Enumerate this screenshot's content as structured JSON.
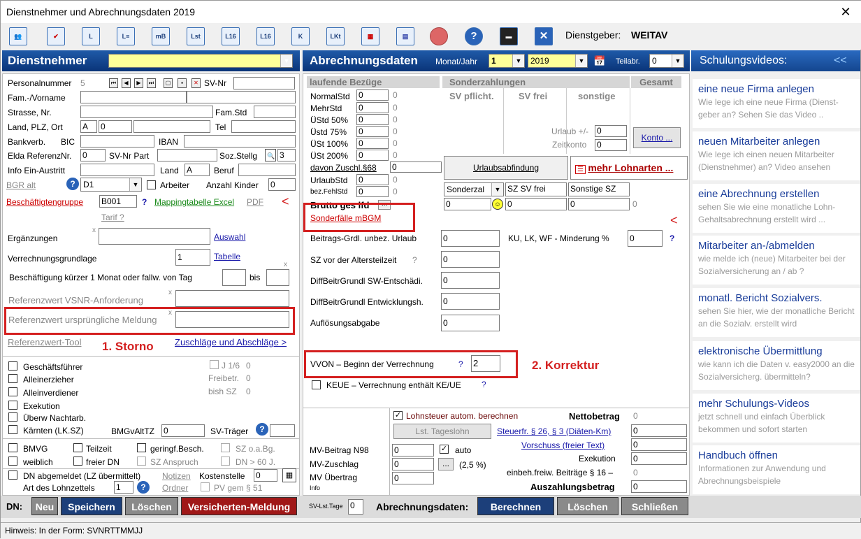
{
  "window": {
    "title": "Dienstnehmer und Abrechnungsdaten 2019",
    "close": "✕"
  },
  "toolbar": {
    "icons": [
      "users-icon",
      "checklist-icon",
      "L",
      "L≡",
      "mB",
      "Lst",
      "L16",
      "L16",
      "K",
      "LKt",
      "calendar-icon",
      "calculator-icon",
      "ball-icon",
      "help-icon",
      "clapper-icon",
      "close-icon"
    ],
    "employer_label": "Dienstgeber:",
    "employer_name": "WEITAV"
  },
  "dn_header": {
    "title": "Dienstnehmer"
  },
  "abr_header": {
    "title": "Abrechnungsdaten",
    "monat_jahr_label": "Monat/Jahr",
    "monat": "1",
    "jahr": "2019",
    "teilabr_label": "Teilabr.",
    "teilabr": "0"
  },
  "videos_header": {
    "title": "Schulungsvideos:",
    "collapse": "<<"
  },
  "dn": {
    "personalnummer_label": "Personalnummer",
    "personalnummer": "5",
    "svnr_label": "SV-Nr",
    "fam_vorname_label": "Fam.-/Vorname",
    "strasse_label": "Strasse, Nr.",
    "famstd_label": "Fam.Std",
    "land_plz_ort_label": "Land, PLZ, Ort",
    "land": "A",
    "plz": "0",
    "tel_label": "Tel",
    "bankverb_label": "Bankverb.",
    "bic_label": "BIC",
    "iban_label": "IBAN",
    "elda_label": "Elda ReferenzNr.",
    "elda": "0",
    "svnr_part_label": "SV-Nr Part",
    "soz_stellg_label": "Soz.Stellg",
    "soz_stellg": "3",
    "info_label": "Info Ein-Austritt",
    "land2_label": "Land",
    "land2": "A",
    "beruf_label": "Beruf",
    "bgr_alt": "BGR alt",
    "bgr_value": "D1",
    "arbeiter_label": "Arbeiter",
    "kinder_label": "Anzahl Kinder",
    "kinder": "0",
    "beschgrp_label": "Beschäftigtengruppe",
    "beschgrp": "B001",
    "q": "?",
    "mapping_label": "Mappingtabelle Excel",
    "pdf_label": "PDF",
    "arrow": "<",
    "tarif": "Tarif ?",
    "ergaenzungen_label": "Ergänzungen",
    "auswahl": "Auswahl",
    "vgl_label": "Verrechnungsgrundlage",
    "vgl": "1",
    "tabelle": "Tabelle",
    "kurz_label": "Beschäftigung kürzer 1 Monat oder fallw. von Tag",
    "bis_label": "bis",
    "ref_vsnr_label": "Referenzwert VSNR-Anforderung",
    "ref_urspr_label": "Referenzwert ursprüngliche Meldung",
    "ref_tool": "Referenzwert-Tool",
    "storno": "1. Storno",
    "zuschlaege": "Zuschläge und Abschläge >",
    "x": "x"
  },
  "checks": {
    "geschaeftsfuehrer": "Geschäftsführer",
    "alleinerzieher": "Alleinerzieher",
    "alleinverdiener": "Alleinverdiener",
    "exekution": "Exekution",
    "ueberw": "Überw Nachtarb.",
    "kaernten": "Kärnten (LK.SZ)",
    "j16_label": "J 1/6",
    "j16": "0",
    "freibetr_label": "Freibetr.",
    "freibetr": "0",
    "bishsz_label": "bish SZ",
    "bishsz": "0",
    "bmgv_label": "BMGvAltTZ",
    "bmgv": "0",
    "svtraeger_label": "SV-Träger",
    "bmvg": "BMVG",
    "teilzeit": "Teilzeit",
    "geringf": "geringf.Besch.",
    "szoabg": "SZ o.a.Bg.",
    "weiblich": "weiblich",
    "freierdn": "freier DN",
    "szanspruch": "SZ Anspruch",
    "dn60": "DN > 60 J.",
    "dnabgemeldet": "DN abgemeldet (LZ übermittelt)",
    "notizen": "Notizen",
    "kostenstelle_label": "Kostenstelle",
    "kostenstelle": "0",
    "art_label": "Art des Lohnzettels",
    "art": "1",
    "ordner": "Ordner",
    "pvgem": "PV gem § 51"
  },
  "lfd": {
    "header": "laufende Bezüge",
    "rows": [
      {
        "label": "NormalStd",
        "v": "0",
        "z": "0"
      },
      {
        "label": "MehrStd",
        "v": "0",
        "z": "0"
      },
      {
        "label": "ÜStd 50%",
        "v": "0",
        "z": "0"
      },
      {
        "label": "Üstd 75%",
        "v": "0",
        "z": "0"
      },
      {
        "label": "ÜSt 100%",
        "v": "0",
        "z": "0"
      },
      {
        "label": "ÜSt 200%",
        "v": "0",
        "z": "0"
      }
    ],
    "davon_label": "davon Zuschl.§68",
    "davon": "0",
    "urlaubstd_label": "UrlaubStd",
    "urlaubstd": "0",
    "urlaubstd_z": "0",
    "fehlstd_label": "bez.FehlStd",
    "fehlstd": "0",
    "fehlstd_z": "0",
    "brutto_label": "Brutto ges lfd",
    "brutto_btn": "..."
  },
  "sz": {
    "header": "Sonderzahlungen",
    "gesamt": "Gesamt",
    "sv_pflicht": "SV pflicht.",
    "sv_frei": "SV frei",
    "sonstige": "sonstige",
    "urlaub_label": "Urlaub +/-",
    "urlaub": "0",
    "zeitkonto_label": "Zeitkonto",
    "zeitkonto": "0",
    "konto_btn": "Konto ...",
    "urlaubsabfindung": "Urlaubsabfindung",
    "mehr_lohnarten": "mehr Lohnarten ...",
    "sonderzal": "Sonderzal",
    "szsvfrei": "SZ SV frei",
    "sonstigesz": "Sonstige SZ",
    "v1": "0",
    "v2": "0",
    "v3": "0",
    "v4": "0"
  },
  "sonder": {
    "sonderfaelle": "Sonderfälle mBGM",
    "arrow": "<",
    "beitrags_label": "Beitrags-Grdl. unbez. Urlaub",
    "beitrags": "0",
    "ku_label": "KU, LK, WF - Minderung %",
    "ku": "0",
    "q": "?",
    "szvor_label": "SZ vor der Altersteilzeit",
    "szvor_q": "?",
    "szvor": "0",
    "diff1_label": "DiffBeitrGrundl SW-Entschädi.",
    "diff1": "0",
    "diff2_label": "DiffBeitrGrundl Entwicklungsh.",
    "diff2": "0",
    "aufl_label": "Auflösungsabgabe",
    "aufl": "0",
    "vvon_label": "VVON – Beginn der Verrechnung",
    "vvon_q": "?",
    "vvon": "2",
    "korrektur": "2. Korrektur",
    "keue_label": "KEUE – Verrechnung enthält KE/UE",
    "keue_q": "?"
  },
  "bottom": {
    "lst_auto": "Lohnsteuer autom. berechnen",
    "netto_label": "Nettobetrag",
    "netto": "0",
    "lst_tageslohn": "Lst. Tageslohn",
    "steuerfr": "Steuerfr. § 26, § 3 (Diäten-Km)",
    "steuerfr_v": "0",
    "vorschuss": "Vorschuss (freier Text)",
    "vorschuss_v": "0",
    "exekution_label": "Exekution",
    "exekution_v": "0",
    "einbeh_label": "einbeh.freiw. Beiträge § 16 –",
    "einbeh_v": "0",
    "auszahlung_label": "Auszahlungsbetrag",
    "auszahlung": "0",
    "mv_beitrag_label": "MV-Beitrag N98",
    "mv_beitrag": "0",
    "auto_label": "auto",
    "mv_zuschlag_label": "MV-Zuschlag",
    "mv_zuschlag": "0",
    "mv_pct": "(2,5 %)",
    "mv_uebertrag_label": "MV Übertrag",
    "mv_uebertrag": "0",
    "info": "Info"
  },
  "actions": {
    "dn_label": "DN:",
    "neu": "Neu",
    "speichern": "Speichern",
    "loeschen": "Löschen",
    "versicherten": "Versicherten-Meldung",
    "svlst_label": "SV-Lst.Tage",
    "svlst": "0",
    "abr_label": "Abrechnungsdaten:",
    "berechnen": "Berechnen",
    "loeschen2": "Löschen",
    "schliessen": "Schließen"
  },
  "status": {
    "text": "Hinweis: In der Form: SVNRTTMMJJ"
  },
  "videos": [
    {
      "title": "eine neue Firma anlegen",
      "sub": "Wie lege ich eine neue Firma (Dienst-geber an? Sehen Sie das Video .."
    },
    {
      "title": "neuen Mitarbeiter anlegen",
      "sub": "Wie lege ich einen neuen Mitarbeiter (Dienstnehmer) an? Video ansehen"
    },
    {
      "title": "eine Abrechnung erstellen",
      "sub": "sehen Sie wie eine monatliche Lohn-Gehaltsabrechnung erstellt wird ..."
    },
    {
      "title": "Mitarbeiter an-/abmelden",
      "sub": "wie melde ich (neue) Mitarbeiter bei der Sozialversicherung an / ab ?"
    },
    {
      "title": "monatl. Bericht Sozialvers.",
      "sub": "sehen Sie hier, wie der monatliche Bericht an die Sozialv. erstellt wird"
    },
    {
      "title": "elektronische Übermittlung",
      "sub": "wie kann ich die Daten v. easy2000 an die Sozialversicherg. übermitteln?"
    },
    {
      "title": "mehr Schulungs-Videos",
      "sub": "jetzt schnell und einfach Überblick bekommen und sofort starten"
    },
    {
      "title": "Handbuch öffnen",
      "sub": "Informationen zur Anwendung und Abrechnungsbeispiele"
    }
  ]
}
